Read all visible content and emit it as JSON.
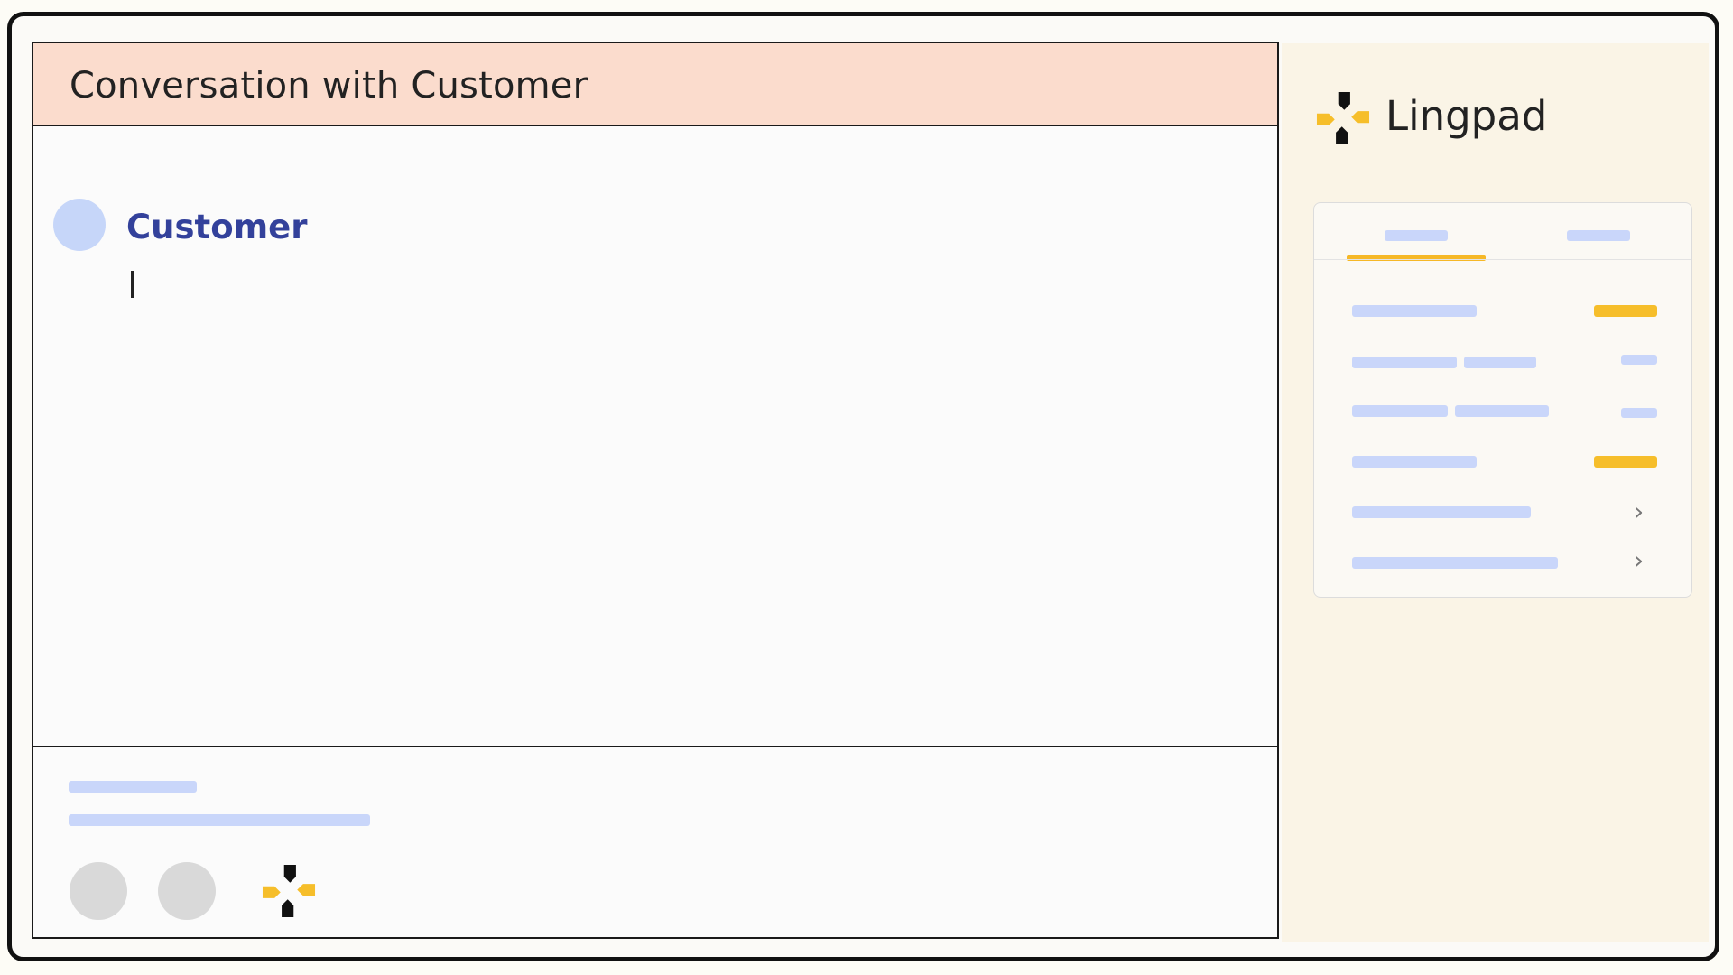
{
  "conversation": {
    "title": "Conversation with Customer",
    "message": {
      "sender": "Customer",
      "text": ""
    }
  },
  "footer": {
    "buttons": [
      {
        "icon": "circle-button"
      },
      {
        "icon": "circle-button"
      },
      {
        "icon": "lingpad-logo-icon"
      }
    ]
  },
  "sidebar": {
    "brand": "Lingpad",
    "card": {
      "tabs": [
        {
          "active": true
        },
        {
          "active": false
        }
      ],
      "rows": [
        {
          "trailing": "yellow-badge"
        },
        {
          "trailing": "blue-badge"
        },
        {
          "trailing": "blue-badge"
        },
        {
          "trailing": "yellow-badge"
        },
        {
          "trailing": "chevron-right-icon"
        },
        {
          "trailing": "chevron-right-icon"
        }
      ]
    }
  },
  "colors": {
    "header_bg": "#fbdccd",
    "sidebar_bg": "#faf4e6",
    "accent_yellow": "#f6be2a",
    "name_blue": "#33419b",
    "skeleton_blue": "#c9d6fa"
  }
}
